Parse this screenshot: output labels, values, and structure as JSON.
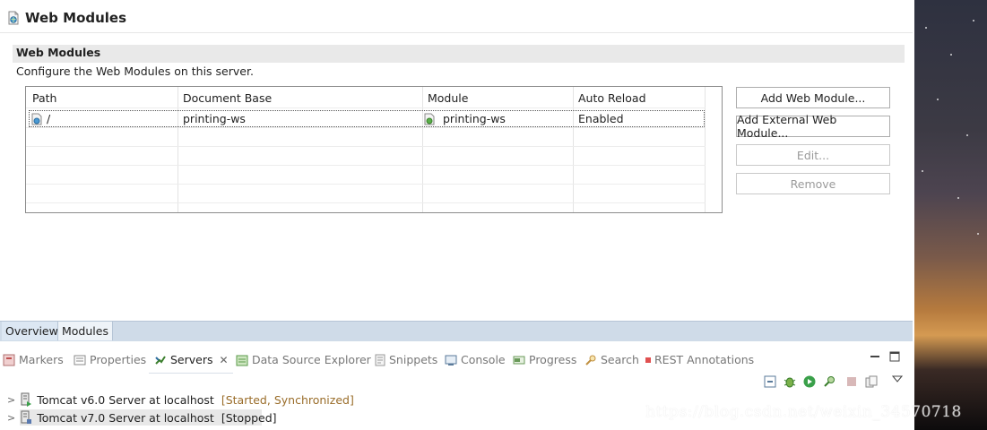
{
  "editor": {
    "title": "Web Modules",
    "section": {
      "title": "Web Modules",
      "description": "Configure the Web Modules on this server."
    },
    "table": {
      "columns": [
        "Path",
        "Document Base",
        "Module",
        "Auto Reload"
      ],
      "rows": [
        {
          "path": "/",
          "document_base": "printing-ws",
          "module": "printing-ws",
          "auto_reload": "Enabled"
        }
      ]
    },
    "buttons": {
      "add_web_module": "Add Web Module...",
      "add_external_web_module": "Add External Web Module...",
      "edit": "Edit...",
      "remove": "Remove"
    },
    "tabs": {
      "overview": "Overview",
      "modules": "Modules"
    }
  },
  "views": {
    "tabs": {
      "markers": "Markers",
      "properties": "Properties",
      "servers": "Servers",
      "data_source_explorer": "Data Source Explorer",
      "snippets": "Snippets",
      "console": "Console",
      "progress": "Progress",
      "search": "Search",
      "rest_annotations": "REST Annotations"
    },
    "servers": [
      {
        "name": "Tomcat v6.0 Server at localhost",
        "status": "[Started, Synchronized]"
      },
      {
        "name": "Tomcat v7.0 Server at localhost",
        "status": "[Stopped]"
      }
    ]
  },
  "watermark": "https://blog.csdn.net/weixin_34570718",
  "colors": {
    "tab_bar": "#cfdbe8",
    "section_header": "#e9e9e9",
    "status_text": "#9a6d2a",
    "rest_marker": "#e05050"
  }
}
